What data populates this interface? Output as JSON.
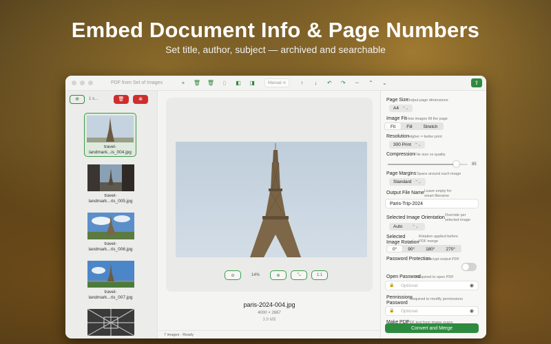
{
  "hero": {
    "title": "Embed Document Info & Page Numbers",
    "subtitle": "Set title, author, subject — archived and searchable"
  },
  "window": {
    "title": "PDF from Set of Images",
    "sort_mode": "Manual ≎"
  },
  "toolbar": {
    "icons": [
      "plus-icon",
      "trash-icon",
      "trash-all-icon",
      "document-icon",
      "sidebar-left-icon",
      "sidebar-right-icon",
      "arrow-up-icon",
      "arrow-down-icon",
      "rotate-left-icon",
      "rotate-right-icon",
      "separator-icon",
      "chevron-up-icon",
      "chevron-down-icon",
      "share-icon"
    ]
  },
  "sidebar": {
    "selection_count": "1 s...",
    "thumbnails": [
      {
        "caption_line1": "travel-",
        "caption_line2": "landmark...is_004.jpg",
        "selected": true
      },
      {
        "caption_line1": "travel-",
        "caption_line2": "landmark...ris_005.jpg",
        "selected": false
      },
      {
        "caption_line1": "travel-",
        "caption_line2": "landmark...ris_006.jpg",
        "selected": false
      },
      {
        "caption_line1": "travel-",
        "caption_line2": "landmark...ris_007.jpg",
        "selected": false
      },
      {
        "caption_line1": "",
        "caption_line2": "",
        "selected": false
      }
    ]
  },
  "preview": {
    "zoom_value": "14%",
    "zoom_reset": "1:1",
    "file_name": "paris-2024-004.jpg",
    "dimensions": "4000 × 2667",
    "file_size": "3.9 MB"
  },
  "status": {
    "text": "7 images  ·  Ready"
  },
  "settings": {
    "page_size": {
      "label": "Page Size",
      "hint": "Output page dimensions",
      "value": "A4"
    },
    "image_fit": {
      "label": "Image Fit",
      "hint": "How images fill the page",
      "options": [
        "Fit",
        "Fill",
        "Stretch"
      ],
      "selected": "Fit"
    },
    "resolution": {
      "label": "Resolution",
      "hint": "Higher = better print",
      "value": "300 Print"
    },
    "compression": {
      "label": "Compression",
      "hint": "File size vs quality",
      "value": "85",
      "level": 0.85
    },
    "page_margins": {
      "label": "Page Margins",
      "hint": "Space around each image",
      "value": "Standard"
    },
    "output_file_name": {
      "label": "Output File Name",
      "hint_line1": "Leave empty for",
      "hint_line2": "smart filename",
      "value": "Paris-Trip-2024"
    },
    "orientation": {
      "label": "Selected Image Orientation",
      "hint_line1": "Override per",
      "hint_line2": "selected image",
      "value": "Auto"
    },
    "rotation": {
      "label_line1": "Selected",
      "label_line2": "Image Rotation",
      "hint_line1": "Rotation applied before",
      "hint_line2": "PDF merge",
      "options": [
        "0°",
        "90°",
        "180°",
        "270°"
      ],
      "selected": "0°"
    },
    "password_protection": {
      "label": "Password Protection",
      "hint": "Encrypt output PDF",
      "enabled": false
    },
    "open_password": {
      "label": "Open Password",
      "hint": "Required to open PDF",
      "placeholder": "Optional"
    },
    "permissions_password": {
      "label_line1": "Permissions",
      "label_line2": "Password",
      "hint": "Required to modify permissions",
      "placeholder": "Optional"
    },
    "make_pdf": {
      "label": "Make PDF",
      "hint": "PDF text from image scans"
    },
    "merge_button": "Convert and Merge"
  },
  "colors": {
    "accent": "#2e8a3f",
    "danger": "#cf2d2d"
  }
}
